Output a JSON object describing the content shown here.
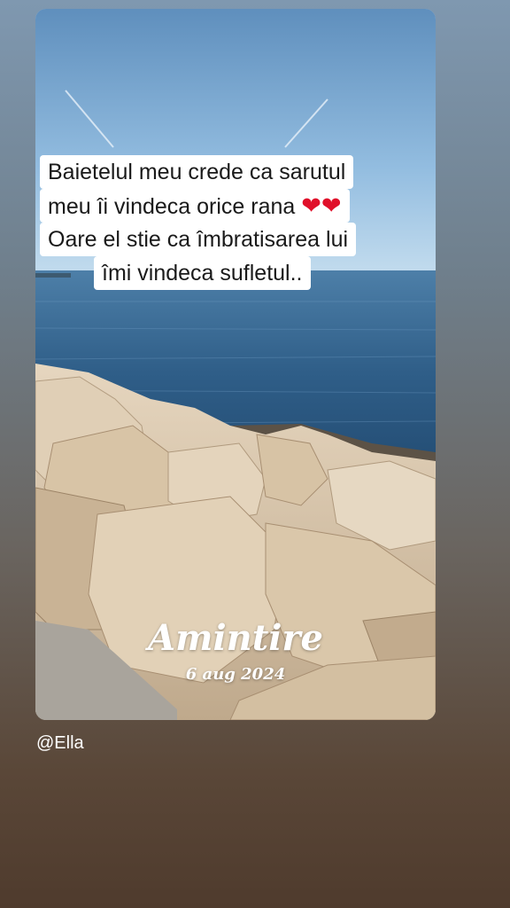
{
  "story": {
    "caption": {
      "line1": "Baietelul meu crede ca sarutul",
      "line2_text": "meu îi vindeca orice rana ",
      "line2_hearts": "❤❤",
      "line3": "Oare el stie ca îmbratisarea lui",
      "line4": "îmi vindeca sufletul.."
    },
    "title": "Amintire",
    "date": "6 aug 2024",
    "author": "@Ella"
  }
}
